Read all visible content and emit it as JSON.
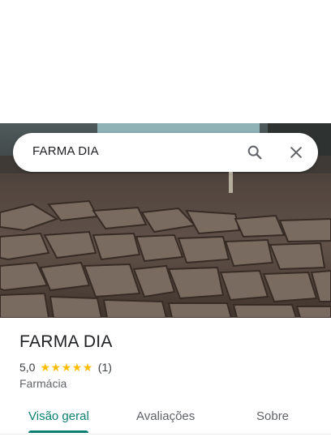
{
  "search": {
    "query": "FARMA DIA"
  },
  "place": {
    "title": "FARMA DIA",
    "rating": "5,0",
    "stars": 5,
    "review_count": "(1)",
    "category": "Farmácia"
  },
  "tabs": [
    {
      "label": "Visão geral",
      "active": true
    },
    {
      "label": "Avaliações",
      "active": false
    },
    {
      "label": "Sobre",
      "active": false
    }
  ],
  "icons": {
    "search": "search-icon",
    "close": "close-icon",
    "star": "star-icon"
  },
  "colors": {
    "accent": "#0b7f71",
    "star": "#fbbc04"
  }
}
